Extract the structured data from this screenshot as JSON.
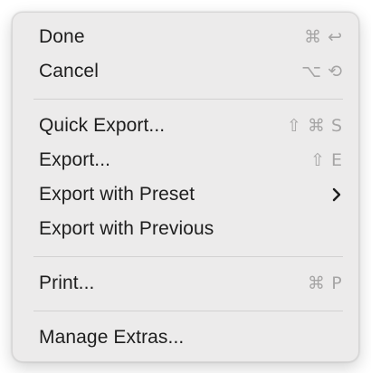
{
  "menu": {
    "items": [
      {
        "label": "Done",
        "shortcut": [
          "⌘",
          "↩"
        ]
      },
      {
        "label": "Cancel",
        "shortcut": [
          "⌥",
          "⟲"
        ]
      },
      {
        "label": "Quick Export...",
        "shortcut": [
          "⇧",
          "⌘",
          "S"
        ]
      },
      {
        "label": "Export...",
        "shortcut": [
          "⇧",
          "E"
        ]
      },
      {
        "label": "Export with Preset",
        "submenu_indicator": "chevron-right-icon"
      },
      {
        "label": "Export with Previous"
      },
      {
        "label": "Print...",
        "shortcut": [
          "⌘",
          "P"
        ]
      },
      {
        "label": "Manage Extras..."
      }
    ]
  },
  "colors": {
    "menu_background": "#ecebeb",
    "label_text": "#1e1e1e",
    "shortcut_text": "#a6a5a5",
    "separator": "#d2d1d1"
  }
}
